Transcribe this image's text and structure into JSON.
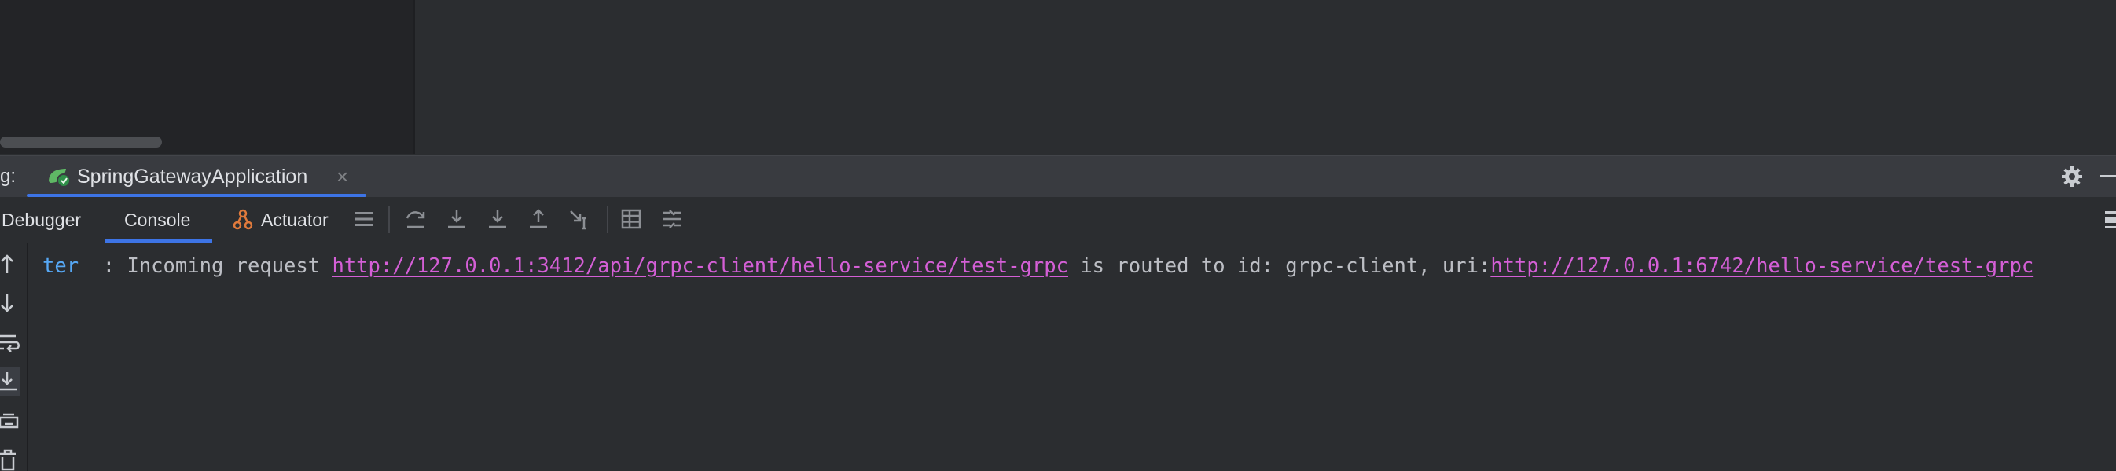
{
  "run_panel": {
    "label": "g:",
    "tab": {
      "title": "SpringGatewayApplication",
      "icon": "spring-boot-icon"
    }
  },
  "toolbar": {
    "tabs": [
      {
        "label": "Debugger"
      },
      {
        "label": "Console"
      },
      {
        "label": "Actuator",
        "icon": "actuator-icon"
      }
    ],
    "icons": [
      "menu-icon",
      "step-over-icon",
      "step-into-icon",
      "force-step-into-icon",
      "step-out-icon",
      "run-to-cursor-icon",
      "evaluate-table-icon",
      "trace-icon"
    ]
  },
  "console": {
    "line": {
      "logger": "ter",
      "text_before": "  : Incoming request ",
      "request_url": "http://127.0.0.1:3412/api/grpc-client/hello-service/test-grpc",
      "text_middle": " is routed to id: grpc-client, uri:",
      "target_url": "http://127.0.0.1:6742/hello-service/test-grpc"
    }
  },
  "colors": {
    "accent": "#3d74e6",
    "link": "#d45fd6",
    "logger": "#56a8f5",
    "background": "#2b2d30"
  }
}
